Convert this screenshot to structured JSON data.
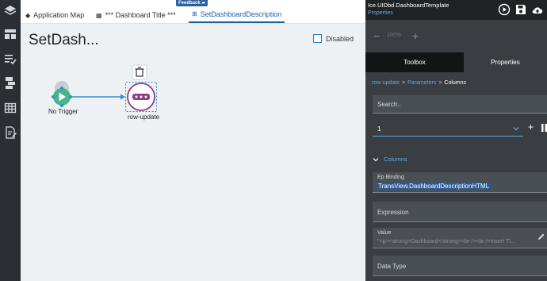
{
  "rail": {
    "icons": [
      "layers-icon",
      "dashboard-layout-icon",
      "list-check-icon",
      "component-tree-icon",
      "table-grid-icon",
      "document-edit-icon"
    ]
  },
  "tabs": {
    "application_map": "Application Map",
    "dashboard_title": "*** Dashboard Title ***",
    "active": "SetDashboardDescription",
    "feedback": "Feedback"
  },
  "canvas": {
    "title": "SetDash...",
    "disabled_label": "Disabled",
    "trigger_label": "No Trigger",
    "widget_label": "row-update"
  },
  "panel": {
    "title": "Ice.UIDbd.DashboardTemplate",
    "subtitle": "Properties",
    "zoom_minus": "−",
    "zoom_value": "100%",
    "zoom_plus": "+",
    "tab_toolbox": "Toolbox",
    "tab_properties": "Properties",
    "breadcrumb": {
      "item1": "row-update",
      "item2": "Parameters",
      "current": "Columns",
      "sep": ">"
    },
    "search_placeholder": "Search..",
    "select_value": "1",
    "add_label": "+",
    "section_title": "Columns",
    "ep_binding_label": "Ep Binding",
    "ep_binding_value": "TransView.DashboardDescriptionHTML",
    "expression_label": "Expression",
    "value_label": "Value",
    "value_text": "\"<p><strong>Dashboard</strong><br /><br />Insert T\\...",
    "data_type_label": "Data Type"
  },
  "colors": {
    "accent": "#1a5ea8",
    "link": "#5aa9e6",
    "panel_bg": "#3a3e42",
    "trigger_green": "#49b38a",
    "widget_purple": "#8e3a8c"
  }
}
